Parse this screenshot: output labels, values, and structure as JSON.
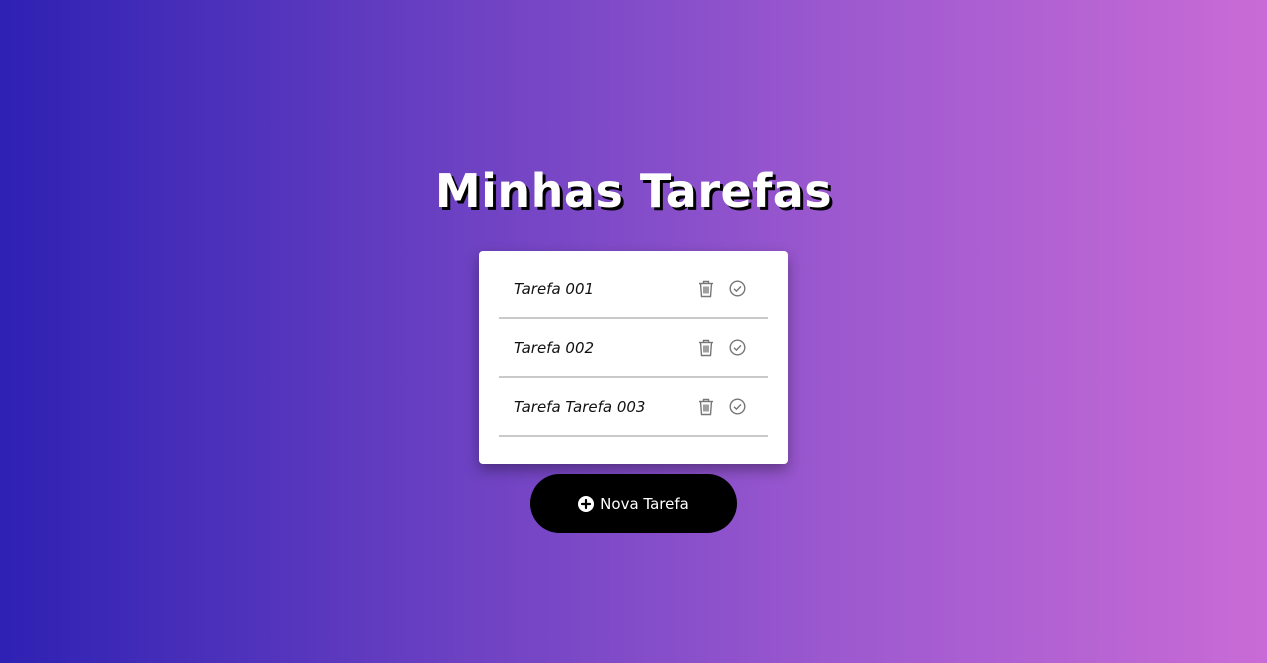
{
  "app": {
    "title": "Minhas Tarefas"
  },
  "tasks": [
    {
      "text": "Tarefa 001",
      "delete_icon": "trash-icon",
      "complete_icon": "check-circle-icon"
    },
    {
      "text": "Tarefa 002",
      "delete_icon": "trash-icon",
      "complete_icon": "check-circle-icon"
    },
    {
      "text": "Tarefa Tarefa 003",
      "delete_icon": "trash-icon",
      "complete_icon": "check-circle-icon"
    }
  ],
  "new_task_button": {
    "label": "Nova Tarefa",
    "icon": "plus-circle-icon"
  },
  "colors": {
    "gradient_start": "#2e21b3",
    "gradient_end": "#c96bd6",
    "button_bg": "#000000",
    "card_bg": "#ffffff",
    "icon_gray": "#777777"
  }
}
